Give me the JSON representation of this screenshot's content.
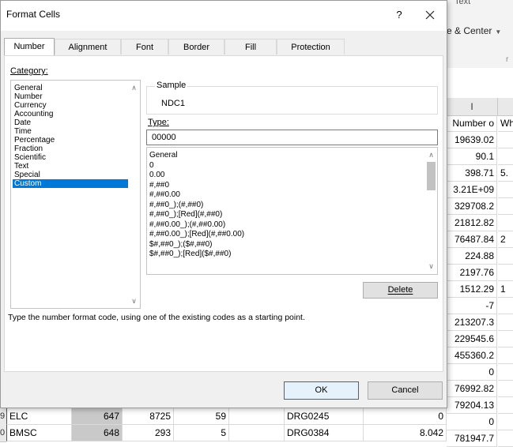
{
  "excel": {
    "ribbon_top_text": "Text",
    "merge_label": "e & Center",
    "group_mark": "r",
    "col_header_I": "I",
    "col_i_values": [
      "Number o",
      "19639.02",
      "90.1",
      "398.71",
      "3.21E+09",
      "329708.2",
      "21812.82",
      "76487.84",
      "224.88",
      "2197.76",
      "1512.29",
      "-7",
      "213207.3",
      "229545.6",
      "455360.2",
      "0",
      "76992.82",
      "79204.13",
      "0",
      "781947.7"
    ],
    "col_j_values": [
      "Wh",
      "",
      "",
      "5.",
      "",
      "",
      "",
      "2",
      "",
      "",
      "1",
      "",
      "",
      "",
      "",
      "",
      "",
      "",
      "",
      ""
    ],
    "bottom_rows": [
      {
        "rownum": "9",
        "code": "ELC",
        "b": "647",
        "c": "8725",
        "d": "59",
        "drg": "DRG0245",
        "g": "0"
      },
      {
        "rownum": "0",
        "code": "BMSC",
        "b": "648",
        "c": "293",
        "d": "5",
        "drg": "DRG0384",
        "g": "8.042"
      }
    ]
  },
  "dialog": {
    "title": "Format Cells",
    "help": "?",
    "tabs": [
      "Number",
      "Alignment",
      "Font",
      "Border",
      "Fill",
      "Protection"
    ],
    "category_label": "Category:",
    "categories": [
      "General",
      "Number",
      "Currency",
      "Accounting",
      "Date",
      "Time",
      "Percentage",
      "Fraction",
      "Scientific",
      "Text",
      "Special",
      "Custom"
    ],
    "selected_category": "Custom",
    "sample_label": "Sample",
    "sample_value": "NDC1",
    "type_label": "Type:",
    "type_value": "00000",
    "formats": [
      "General",
      "0",
      "0.00",
      "#,##0",
      "#,##0.00",
      "#,##0_);(#,##0)",
      "#,##0_);[Red](#,##0)",
      "#,##0.00_);(#,##0.00)",
      "#,##0.00_);[Red](#,##0.00)",
      "$#,##0_);($#,##0)",
      "$#,##0_);[Red]($#,##0)"
    ],
    "delete_label": "Delete",
    "hint": "Type the number format code, using one of the existing codes as a starting point.",
    "ok_label": "OK",
    "cancel_label": "Cancel"
  }
}
